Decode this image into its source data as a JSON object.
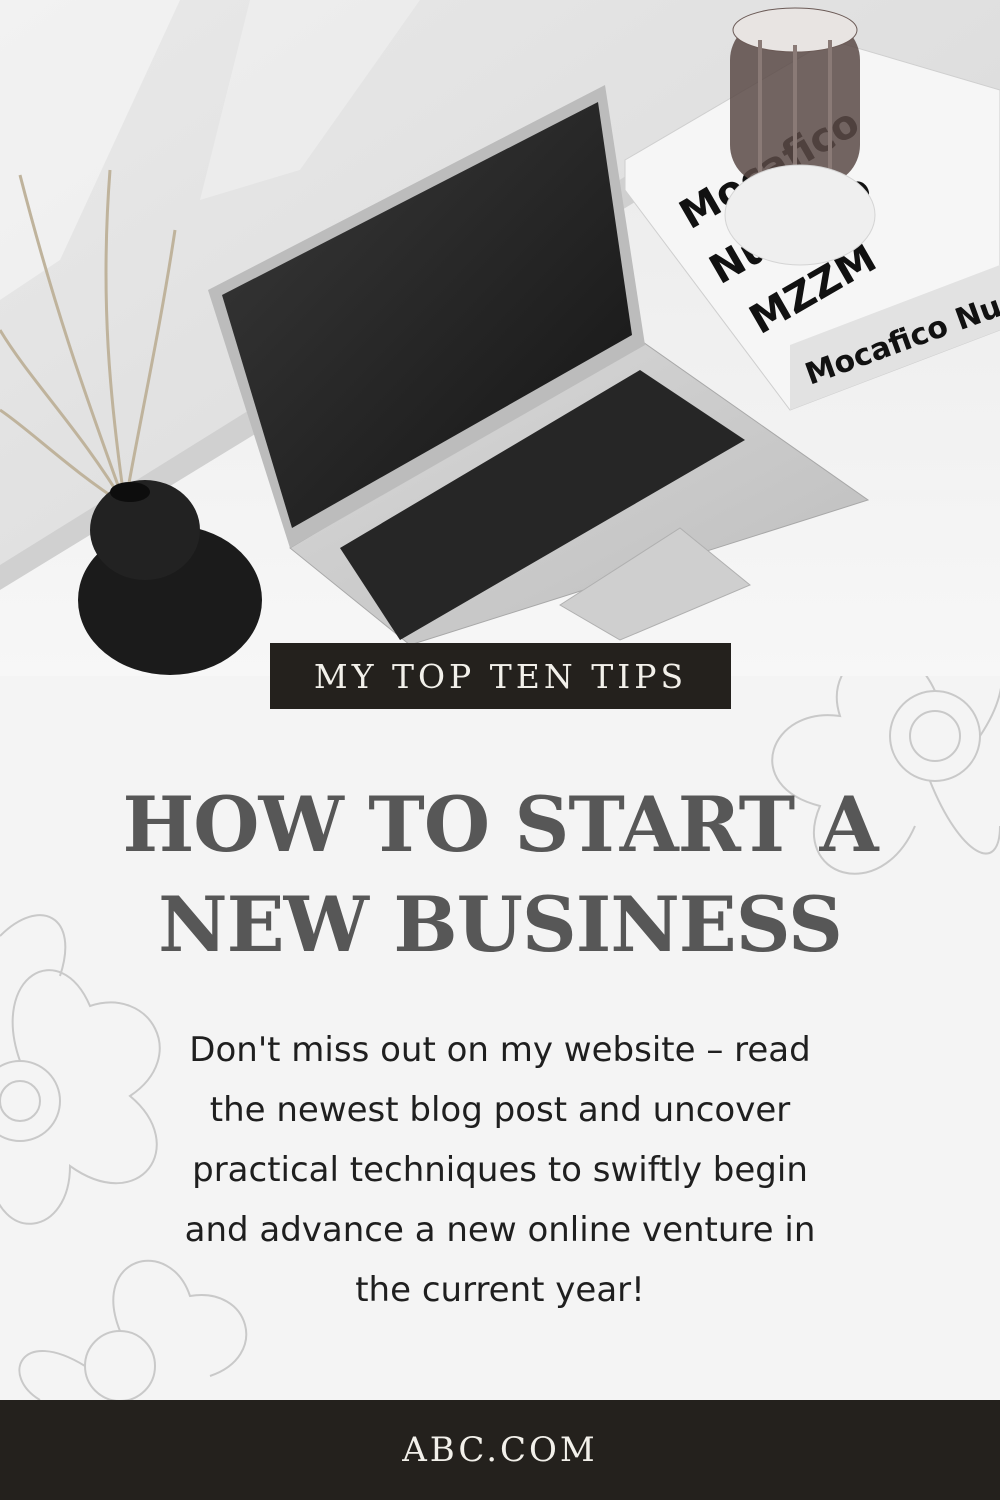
{
  "hero": {
    "book_text": "Mocafico Numero"
  },
  "tag": {
    "label": "MY TOP TEN TIPS"
  },
  "title": {
    "line1": "HOW TO START A",
    "line2": "NEW BUSINESS"
  },
  "body": {
    "line1": "Don't miss out on my website – read",
    "line2": "the newest blog post and uncover",
    "line3": "practical techniques to swiftly begin",
    "line4": "and advance a new online venture in",
    "line5": "the current year!"
  },
  "footer": {
    "link": "ABC.COM"
  },
  "colors": {
    "background": "#f4f4f4",
    "dark_band": "#24211d",
    "title": "#575757",
    "body_text": "#1f1f1f"
  }
}
